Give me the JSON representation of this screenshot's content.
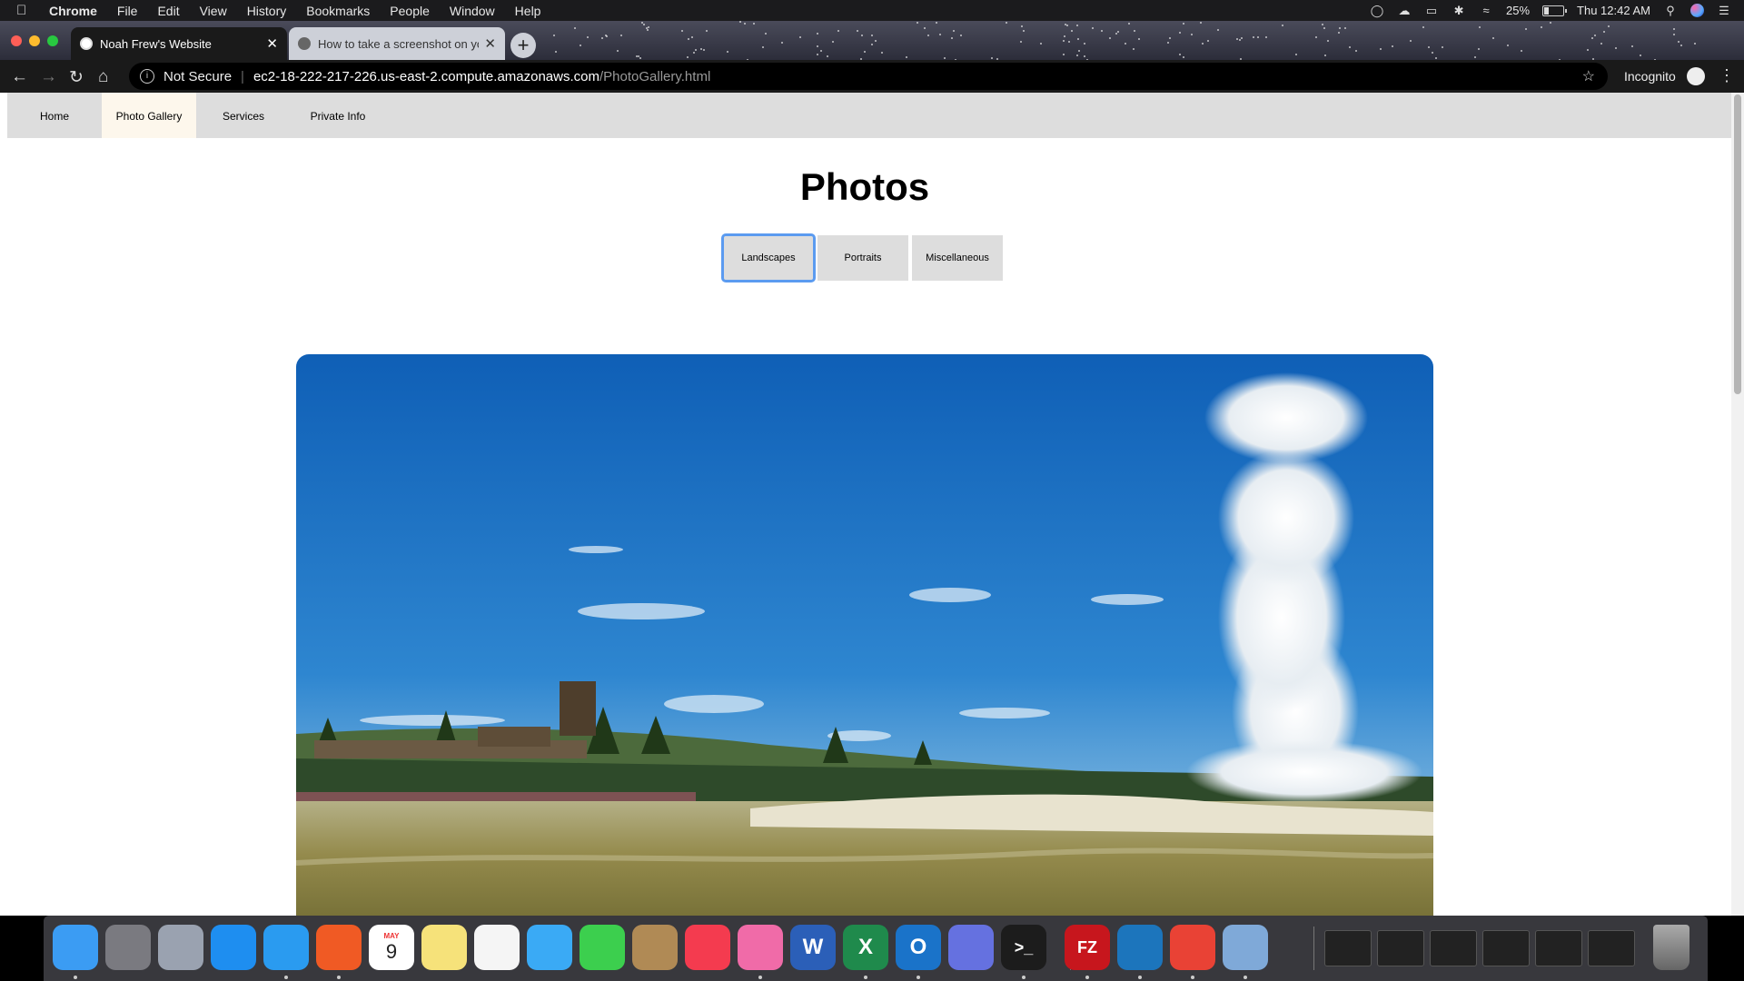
{
  "menubar": {
    "app": "Chrome",
    "items": [
      "File",
      "Edit",
      "View",
      "History",
      "Bookmarks",
      "People",
      "Window",
      "Help"
    ],
    "battery": "25%",
    "battery_level": 0.25,
    "clock": "Thu 12:42 AM"
  },
  "tabs": [
    {
      "title": "Noah Frew's Website",
      "active": true
    },
    {
      "title": "How to take a screenshot on yo",
      "active": false
    }
  ],
  "omnibox": {
    "security": "Not Secure",
    "host": "ec2-18-222-217-226.us-east-2.compute.amazonaws.com",
    "path": "/PhotoGallery.html"
  },
  "profile": {
    "label": "Incognito"
  },
  "site": {
    "nav": [
      "Home",
      "Photo Gallery",
      "Services",
      "Private Info"
    ],
    "active_nav": "Photo Gallery",
    "heading": "Photos",
    "filters": [
      "Landscapes",
      "Portraits",
      "Miscellaneous"
    ],
    "focused_filter": "Landscapes"
  },
  "dock": {
    "apps": [
      {
        "name": "Finder",
        "icon": "finder-icon",
        "color": "#3b9cf3",
        "running": true
      },
      {
        "name": "System Preferences",
        "icon": "gear-icon",
        "color": "#7a7a80",
        "running": false
      },
      {
        "name": "Launchpad",
        "icon": "rocket-icon",
        "color": "#9aa2b0",
        "running": false
      },
      {
        "name": "App Store",
        "icon": "app-store-icon",
        "color": "#1e8ef0",
        "running": false
      },
      {
        "name": "Safari",
        "icon": "compass-icon",
        "color": "#2a9bf0",
        "running": true
      },
      {
        "name": "Brave",
        "icon": "lion-icon",
        "color": "#f05a24",
        "running": true
      },
      {
        "name": "Calendar",
        "icon": "calendar-icon",
        "color": "#ffffff",
        "running": false,
        "label_top": "MAY",
        "label_day": "9"
      },
      {
        "name": "Notes",
        "icon": "notepad-icon",
        "color": "#f6e27a",
        "running": false
      },
      {
        "name": "Photos",
        "icon": "flower-icon",
        "color": "#f5f5f5",
        "running": false
      },
      {
        "name": "Messages",
        "icon": "chat-bubble-icon",
        "color": "#3aaaf5",
        "running": false
      },
      {
        "name": "FaceTime",
        "icon": "video-camera-icon",
        "color": "#3ccf4e",
        "running": false
      },
      {
        "name": "Contacts",
        "icon": "address-book-icon",
        "color": "#b08a55",
        "running": false
      },
      {
        "name": "News",
        "icon": "news-icon",
        "color": "#f43b4f",
        "running": false
      },
      {
        "name": "iTunes",
        "icon": "music-note-icon",
        "color": "#f06ba8",
        "running": true
      },
      {
        "name": "Word",
        "icon": "word-icon",
        "color": "#2b5fb8",
        "running": false,
        "letter": "W"
      },
      {
        "name": "Excel",
        "icon": "excel-icon",
        "color": "#1f8a4c",
        "running": true,
        "letter": "X"
      },
      {
        "name": "Outlook",
        "icon": "outlook-icon",
        "color": "#1a73c9",
        "running": true,
        "letter": "O"
      },
      {
        "name": "Discord",
        "icon": "discord-icon",
        "color": "#6571e0",
        "running": false
      },
      {
        "name": "Terminal",
        "icon": "terminal-icon",
        "color": "#1c1c1c",
        "running": true,
        "letter": ">_"
      },
      {
        "name": "FileZilla",
        "icon": "filezilla-icon",
        "color": "#c7161d",
        "running": true,
        "letter": "FZ"
      },
      {
        "name": "Remote Desktop",
        "icon": "remote-desktop-icon",
        "color": "#1c75bc",
        "running": true
      },
      {
        "name": "Google Chrome",
        "icon": "chrome-icon",
        "color": "#e94235",
        "running": true
      },
      {
        "name": "Preview",
        "icon": "preview-icon",
        "color": "#7fa9d8",
        "running": true
      }
    ],
    "minimized": 6,
    "trash": "trash-icon"
  }
}
